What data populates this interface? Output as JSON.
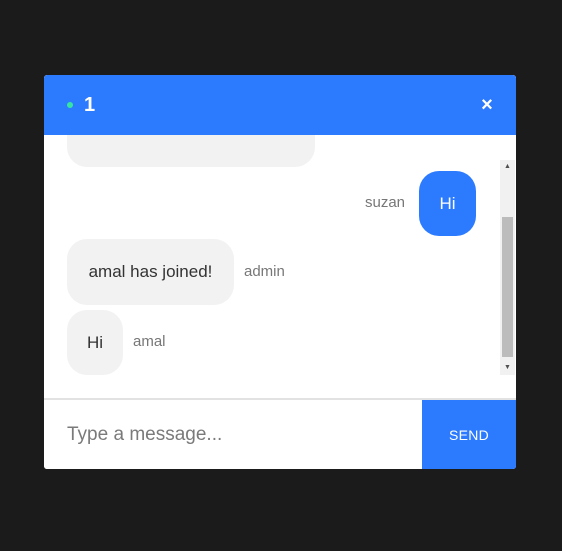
{
  "header": {
    "room_count": "1",
    "close_label": "×",
    "status_color": "#36e6a0"
  },
  "messages": [
    {
      "sender": "suzan",
      "text": "Hi",
      "mine": true
    },
    {
      "sender": "admin",
      "text": "amal has joined!",
      "mine": false
    },
    {
      "sender": "amal",
      "text": "Hi",
      "mine": false
    }
  ],
  "composer": {
    "placeholder": "Type a message...",
    "value": "",
    "send_label": "SEND"
  },
  "colors": {
    "accent": "#2c7bff",
    "bubble_other": "#f2f2f2",
    "backdrop": "#1b1b1c"
  }
}
